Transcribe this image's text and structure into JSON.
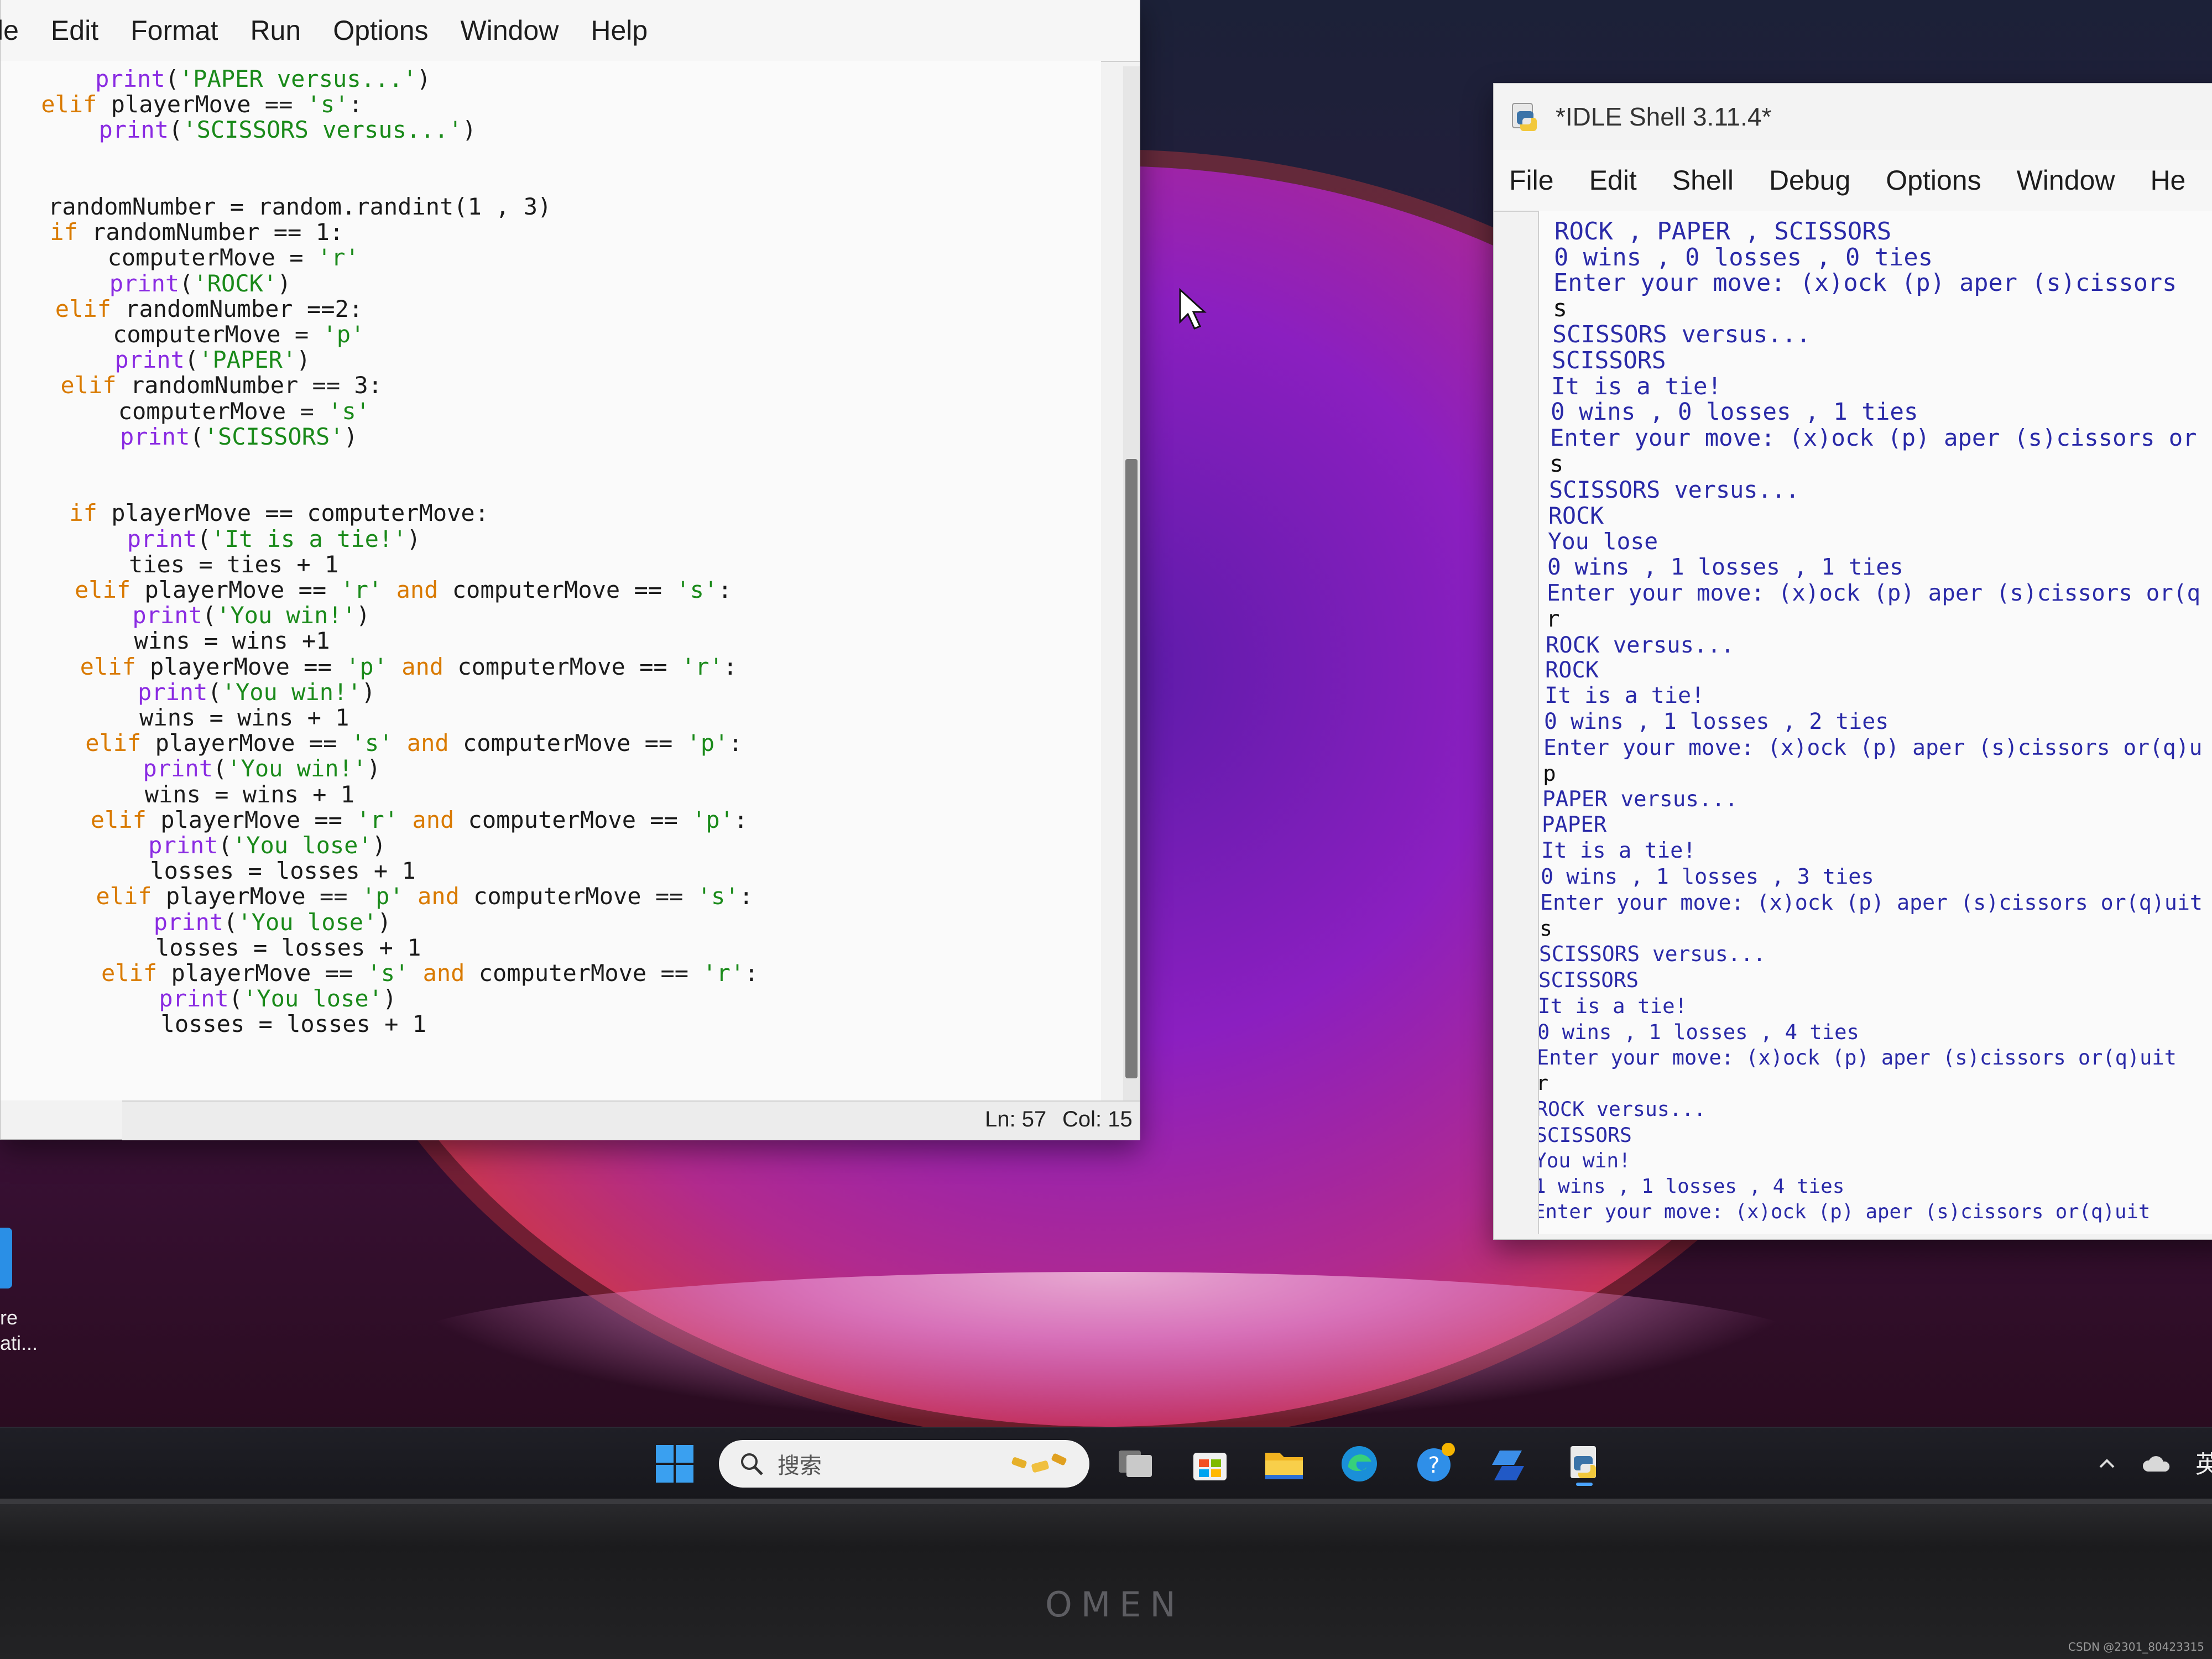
{
  "editor": {
    "menu": [
      "le",
      "Edit",
      "Format",
      "Run",
      "Options",
      "Window",
      "Help"
    ],
    "status": {
      "line": "Ln: 57",
      "col": "Col: 15"
    },
    "code": [
      "    print('PAPER versus...')",
      "elif playerMove == 's':",
      "    print('SCISSORS versus...')",
      "",
      "",
      "randomNumber = random.randint(1 , 3)",
      "if randomNumber == 1:",
      "    computerMove = 'r'",
      "    print('ROCK')",
      "elif randomNumber ==2:",
      "    computerMove = 'p'",
      "    print('PAPER')",
      "elif randomNumber == 3:",
      "    computerMove = 's'",
      "    print('SCISSORS')",
      "",
      "",
      "if playerMove == computerMove:",
      "    print('It is a tie!')",
      "    ties = ties + 1",
      "elif playerMove == 'r' and computerMove == 's':",
      "    print('You win!')",
      "    wins = wins +1",
      "elif playerMove == 'p' and computerMove == 'r':",
      "    print('You win!')",
      "    wins = wins + 1",
      "elif playerMove == 's' and computerMove == 'p':",
      "    print('You win!')",
      "    wins = wins + 1",
      "elif playerMove == 'r' and computerMove == 'p':",
      "    print('You lose')",
      "    losses = losses + 1",
      "elif playerMove == 'p' and computerMove == 's':",
      "    print('You lose')",
      "    losses = losses + 1",
      "elif playerMove == 's' and computerMove == 'r':",
      "    print('You lose')",
      "    losses = losses + 1"
    ]
  },
  "shell": {
    "title": "*IDLE Shell 3.11.4*",
    "menu": [
      "File",
      "Edit",
      "Shell",
      "Debug",
      "Options",
      "Window",
      "He"
    ],
    "output": [
      "ROCK , PAPER , SCISSORS",
      "0 wins , 0 losses , 0 ties",
      "Enter your move: (x)ock (p) aper (s)cissors",
      "s",
      "SCISSORS versus...",
      "SCISSORS",
      "It is a tie!",
      "0 wins , 0 losses , 1 ties",
      "Enter your move: (x)ock (p) aper (s)cissors or",
      "s",
      "SCISSORS versus...",
      "ROCK",
      "You lose",
      "0 wins , 1 losses , 1 ties",
      "Enter your move: (x)ock (p) aper (s)cissors or(q",
      "r",
      "ROCK versus...",
      "ROCK",
      "It is a tie!",
      "0 wins , 1 losses , 2 ties",
      "Enter your move: (x)ock (p) aper (s)cissors or(q)u",
      "p",
      "PAPER versus...",
      "PAPER",
      "It is a tie!",
      "0 wins , 1 losses , 3 ties",
      "Enter your move: (x)ock (p) aper (s)cissors or(q)uit",
      "s",
      "SCISSORS versus...",
      "SCISSORS",
      "It is a tie!",
      "0 wins , 1 losses , 4 ties",
      "Enter your move: (x)ock (p) aper (s)cissors or(q)uit",
      "r",
      "ROCK versus...",
      "SCISSORS",
      "You win!",
      "1 wins , 1 losses , 4 ties",
      "Enter your move: (x)ock (p) aper (s)cissors or(q)uit"
    ],
    "input_lines": [
      3,
      9,
      15,
      21,
      27,
      33
    ]
  },
  "desktop": {
    "icon_label_1": "re",
    "icon_label_2": "ati..."
  },
  "taskbar": {
    "search_placeholder": "搜索",
    "icons": [
      "windows-start-icon",
      "task-view-icon",
      "microsoft-store-icon",
      "file-explorer-icon",
      "edge-browser-icon",
      "get-help-icon",
      "app-icon",
      "idle-python-icon"
    ],
    "tray_lang": "英"
  },
  "bezel": {
    "logo": "OMEN"
  },
  "watermark": "CSDN @2301_80423315",
  "colors": {
    "keyword": "#d97a00",
    "string": "#1a8a1a",
    "shell_output": "#2a2aa8",
    "builtin": "#8a2be2"
  }
}
